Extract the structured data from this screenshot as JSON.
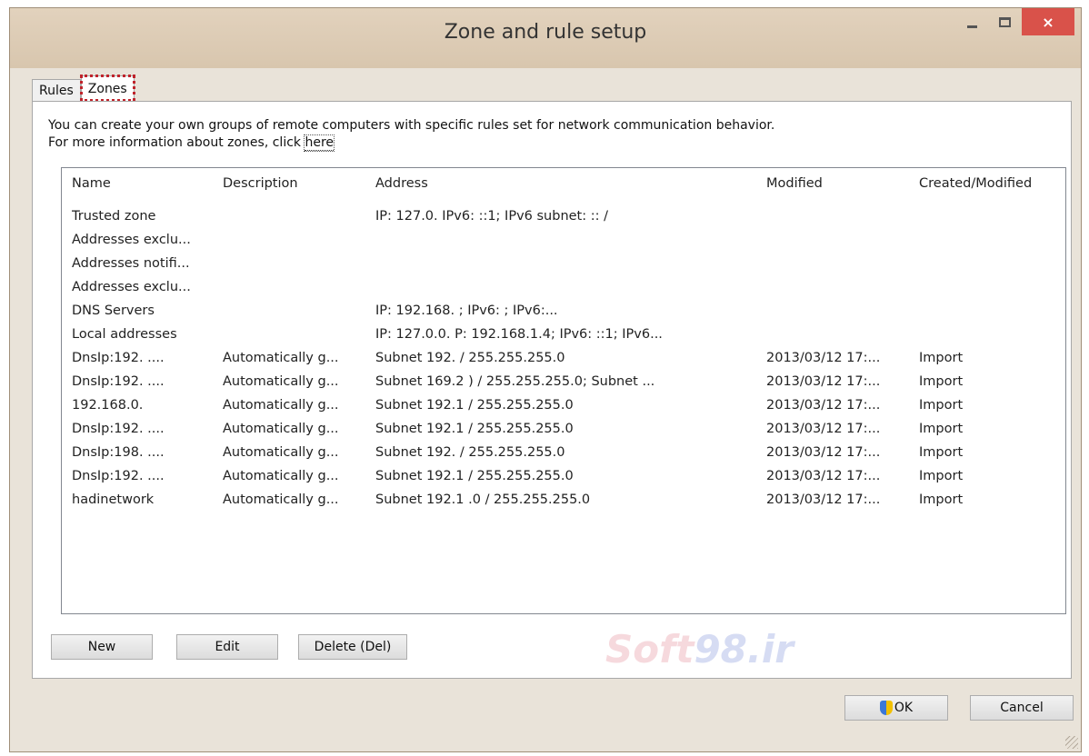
{
  "window": {
    "title": "Zone and rule setup",
    "close_glyph": "×"
  },
  "tabs": [
    {
      "label": "Rules",
      "active": false
    },
    {
      "label": "Zones",
      "active": true
    }
  ],
  "description": {
    "line1": "You can create your own groups of remote computers with specific rules set for network communication behavior.",
    "line2_prefix": "For more information about zones, click ",
    "link_text": "here"
  },
  "table": {
    "columns": [
      "Name",
      "Description",
      "Address",
      "Modified",
      "Created/Modified"
    ],
    "rows": [
      {
        "name": "Trusted zone",
        "description": "",
        "address": "IP: 127.0.  IPv6: ::1; IPv6 subnet:  :: /",
        "modified": "",
        "created": ""
      },
      {
        "name": "Addresses exclu...",
        "description": "",
        "address": "",
        "modified": "",
        "created": ""
      },
      {
        "name": "Addresses notifi...",
        "description": "",
        "address": "",
        "modified": "",
        "created": ""
      },
      {
        "name": "Addresses exclu...",
        "description": "",
        "address": "",
        "modified": "",
        "created": ""
      },
      {
        "name": "DNS Servers",
        "description": "",
        "address": "IP: 192.168.  ; IPv6:  ; IPv6:...",
        "modified": "",
        "created": ""
      },
      {
        "name": "Local addresses",
        "description": "",
        "address": "IP: 127.0.0.  P: 192.168.1.4; IPv6: ::1; IPv6...",
        "modified": "",
        "created": ""
      },
      {
        "name": "DnsIp:192.  ....",
        "description": "Automatically g...",
        "address": "Subnet 192.  / 255.255.255.0",
        "modified": "2013/03/12 17:...",
        "created": "Import"
      },
      {
        "name": "DnsIp:192.  ....",
        "description": "Automatically g...",
        "address": "Subnet 169.2  ) / 255.255.255.0; Subnet ...",
        "modified": "2013/03/12 17:...",
        "created": "Import"
      },
      {
        "name": "192.168.0.",
        "description": "Automatically g...",
        "address": "Subnet 192.1  / 255.255.255.0",
        "modified": "2013/03/12 17:...",
        "created": "Import"
      },
      {
        "name": "DnsIp:192.  ....",
        "description": "Automatically g...",
        "address": "Subnet 192.1  / 255.255.255.0",
        "modified": "2013/03/12 17:...",
        "created": "Import"
      },
      {
        "name": "DnsIp:198.  ....",
        "description": "Automatically g...",
        "address": "Subnet 192.  / 255.255.255.0",
        "modified": "2013/03/12 17:...",
        "created": "Import"
      },
      {
        "name": "DnsIp:192.  ....",
        "description": "Automatically g...",
        "address": "Subnet 192.1  / 255.255.255.0",
        "modified": "2013/03/12 17:...",
        "created": "Import"
      },
      {
        "name": "hadinetwork",
        "description": "Automatically g...",
        "address": "Subnet 192.1  .0 / 255.255.255.0",
        "modified": "2013/03/12 17:...",
        "created": "Import"
      }
    ]
  },
  "buttons": {
    "new": "New",
    "edit": "Edit",
    "delete": "Delete (Del)",
    "ok": "OK",
    "cancel": "Cancel"
  },
  "watermark": {
    "part1": "Soft",
    "part2": "98.ir"
  },
  "colors": {
    "close_button": "#d9524a",
    "active_tab_highlight": "#c0242c",
    "titlebar": "#e2d2bd"
  },
  "icons": {
    "ok": "shield-icon"
  }
}
